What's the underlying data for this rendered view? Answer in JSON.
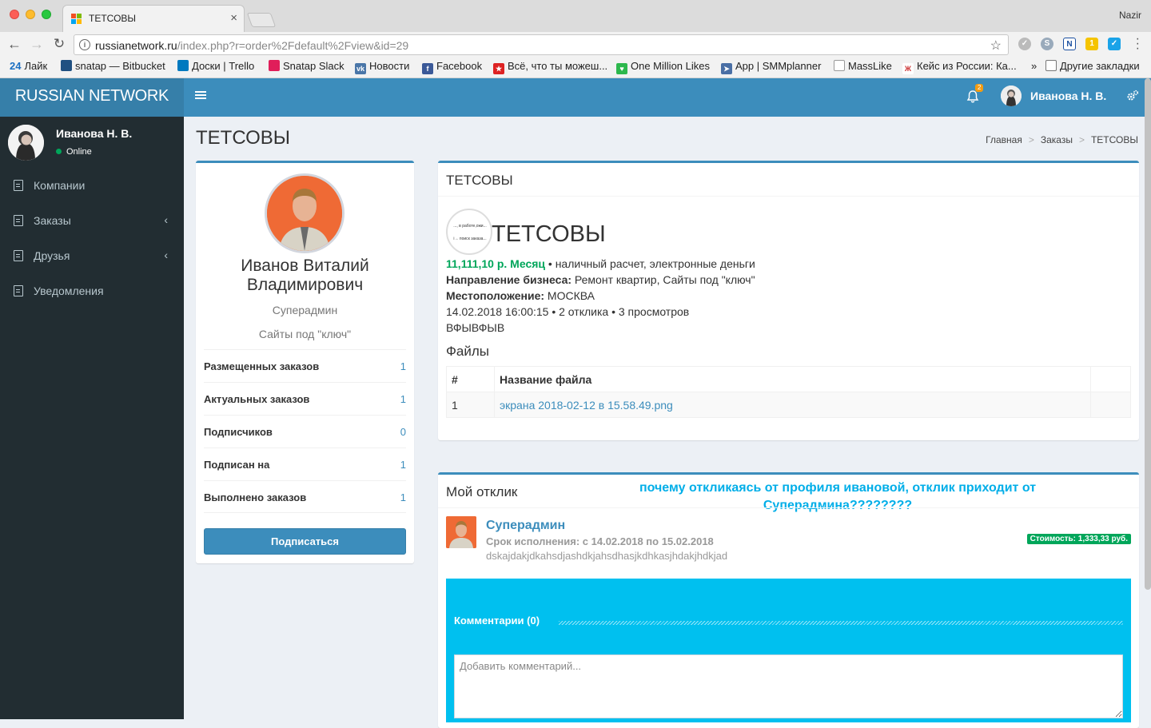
{
  "browser": {
    "tab_title": "ТЕТСОВЫ",
    "user": "Nazir",
    "url_host": "russianetwork.ru",
    "url_path": "/index.php?r=order%2Fdefault%2Fview&id=29",
    "bookmarks": [
      "Лайк",
      "snatap — Bitbucket",
      "Доски | Trello",
      "Snatap Slack",
      "Новости",
      "Facebook",
      "Всё, что ты можеш...",
      "One Million Likes",
      "App | SMMplanner",
      "MassLike",
      "Кейс из России: Ка...",
      "»",
      "Другие закладки"
    ],
    "bookmark_24": "24"
  },
  "header": {
    "logo": "RUSSIAN NETWORK",
    "notif_count": "2",
    "user_name": "Иванова Н. В."
  },
  "sidebar": {
    "user_name": "Иванова Н. В.",
    "status": "Online",
    "items": [
      {
        "label": "Компании"
      },
      {
        "label": "Заказы"
      },
      {
        "label": "Друзья"
      },
      {
        "label": "Уведомления"
      }
    ]
  },
  "page": {
    "title": "ТЕТСОВЫ",
    "breadcrumb": [
      "Главная",
      "Заказы",
      "ТЕТСОВЫ"
    ]
  },
  "profile": {
    "name": "Иванов Виталий Владимирович",
    "role": "Суперадмин",
    "spec": "Сайты под \"ключ\"",
    "stats": [
      {
        "label": "Размещенных заказов",
        "value": "1"
      },
      {
        "label": "Актуальных заказов",
        "value": "1"
      },
      {
        "label": "Подписчиков",
        "value": "0"
      },
      {
        "label": "Подписан на",
        "value": "1"
      },
      {
        "label": "Выполнено заказов",
        "value": "1"
      }
    ],
    "subscribe": "Подписаться"
  },
  "order": {
    "box_title": "ТЕТСОВЫ",
    "logo_line1": "..., в работе,ожи...",
    "logo_line2": "i→ поиск заказа...",
    "title": "ТЕТСОВЫ",
    "price": "11,111,10 р. Месяц",
    "payment": " • наличный расчет, электронные деньги",
    "business_label": "Направление бизнеса:",
    "business": " Ремонт квартир, Сайты под \"ключ\"",
    "location_label": "Местоположение:",
    "location": " МОСКВА",
    "meta": "14.02.2018 16:00:15 • 2 отклика • 3 просмотров",
    "description": "ВФЫВФЫВ",
    "files_heading": "Файлы",
    "files_cols": [
      "#",
      "Название файла",
      ""
    ],
    "files": [
      {
        "num": "1",
        "name": "экрана 2018-02-12 в 15.58.49.png"
      }
    ]
  },
  "response": {
    "title": "Мой отклик",
    "annotation": "почему откликаясь от профиля ивановой, отклик приходит от Суперадмина????????",
    "author": "Суперадмин",
    "term": "Срок исполнения: с 14.02.2018 по 15.02.2018",
    "text": "dskajdakjdkahsdjashdkjahsdhasjkdhkasjhdakjhdkjad",
    "cost": "Стоимость: 1,333,33 руб.",
    "comments_title": "Комментарии (0)",
    "comment_placeholder": "Добавить комментарий..."
  },
  "colors": {
    "brand": "#3c8dbc",
    "sidebar": "#222d32",
    "success": "#00a65a",
    "info": "#00c0ef",
    "annotation": "#00aee8"
  }
}
